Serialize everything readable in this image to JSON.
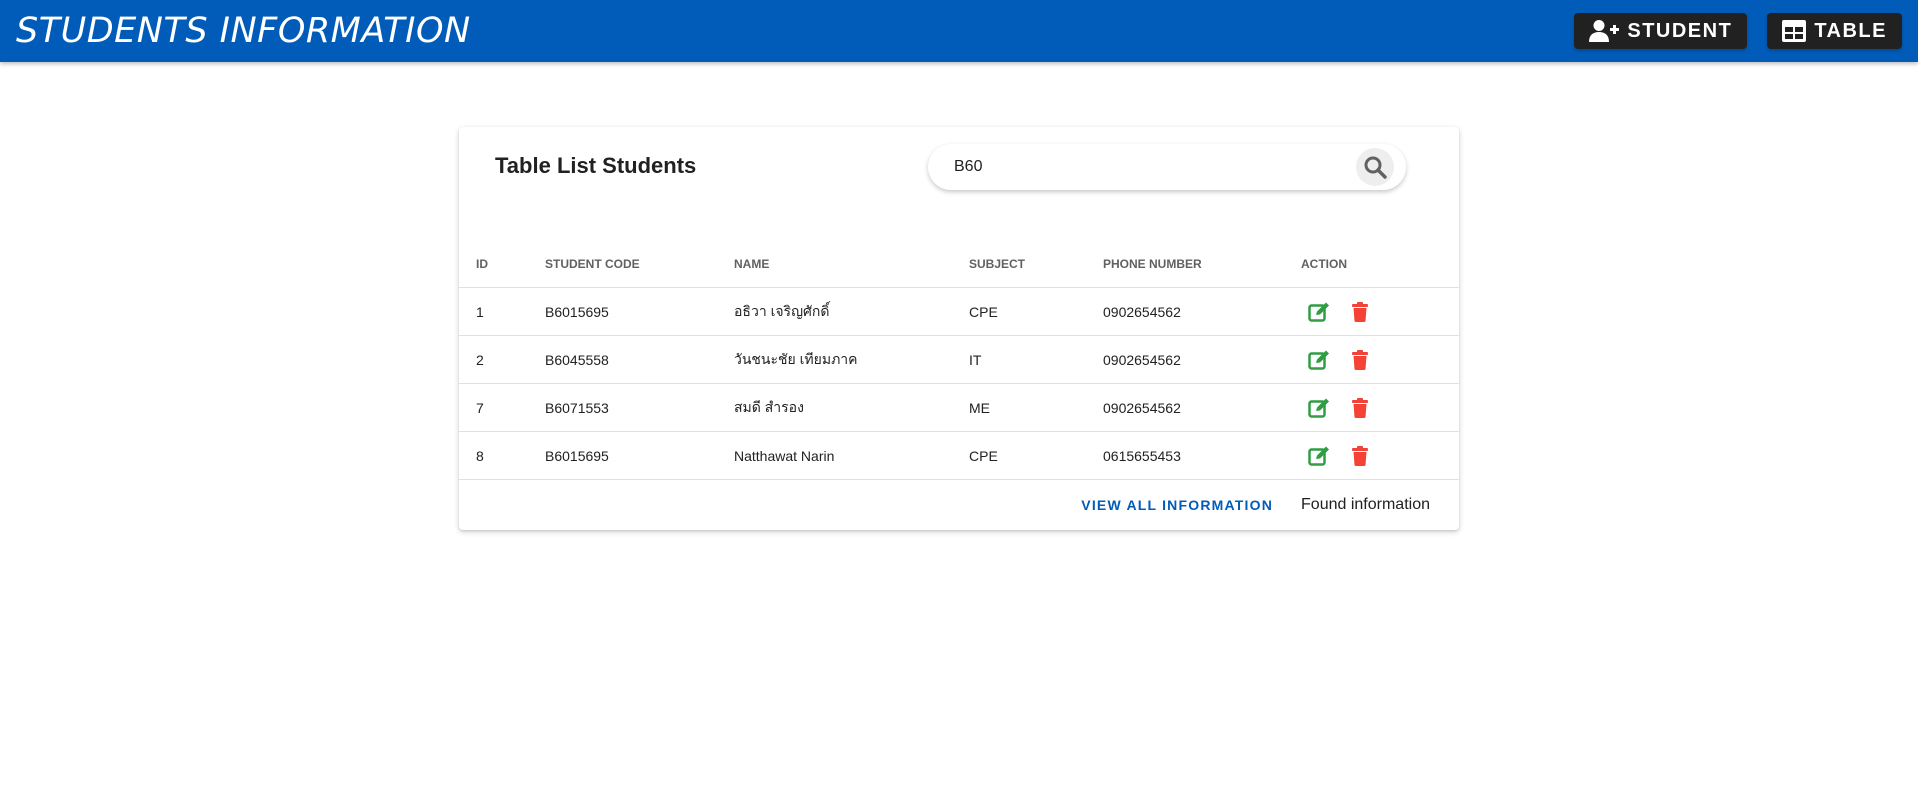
{
  "app": {
    "title": "STUDENTS INFORMATION",
    "brand_color": "#005cb8"
  },
  "nav": {
    "student_label": "STUDENT",
    "table_label": "TABLE"
  },
  "card": {
    "title": "Table List Students"
  },
  "search": {
    "value": "B60",
    "placeholder": ""
  },
  "table": {
    "headers": {
      "id": "ID",
      "code": "STUDENT CODE",
      "name": "NAME",
      "subject": "SUBJECT",
      "phone": "PHONE NUMBER",
      "action": "ACTION"
    },
    "rows": [
      {
        "id": "1",
        "code": "B6015695",
        "name": "อธิวา เจริญศักดิ์",
        "subject": "CPE",
        "phone": "0902654562"
      },
      {
        "id": "2",
        "code": "B6045558",
        "name": "วันชนะชัย เทียมภาค",
        "subject": "IT",
        "phone": "0902654562"
      },
      {
        "id": "7",
        "code": "B6071553",
        "name": "สมดี สำรอง",
        "subject": "ME",
        "phone": "0902654562"
      },
      {
        "id": "8",
        "code": "B6015695",
        "name": "Natthawat Narin",
        "subject": "CPE",
        "phone": "0615655453"
      }
    ],
    "edit_icon": "edit-icon",
    "delete_icon": "trash-icon",
    "edit_color": "#2e9e44",
    "delete_color": "#f44336"
  },
  "footer": {
    "view_all_label": "VIEW ALL INFORMATION",
    "status_text": "Found information"
  }
}
